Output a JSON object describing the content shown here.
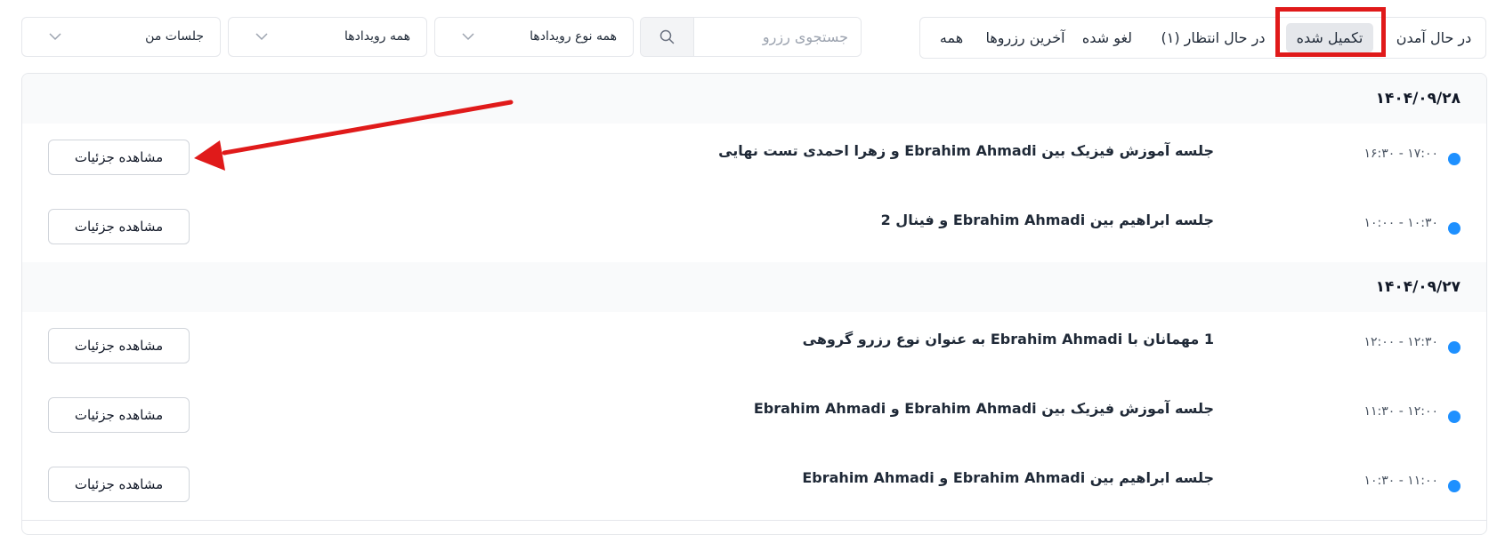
{
  "tabs": [
    {
      "label": "در حال آمدن",
      "active": false
    },
    {
      "label": "تکمیل شده",
      "active": true
    },
    {
      "label": "در حال انتظار (۱)",
      "active": false
    },
    {
      "label": "لغو شده",
      "active": false
    },
    {
      "label": "آخرین رزروها",
      "active": false
    },
    {
      "label": "همه",
      "active": false
    }
  ],
  "search": {
    "placeholder": "جستجوی رزرو"
  },
  "filters": {
    "event_type": "همه نوع رویدادها",
    "events": "همه رویدادها",
    "sessions": "جلسات من"
  },
  "details_label": "مشاهده جزئیات",
  "groups": [
    {
      "date": "۱۴۰۴/۰۹/۲۸",
      "events": [
        {
          "time": "۱۶:۳۰ - ۱۷:۰۰",
          "title": "جلسه آموزش فیزیک بین Ebrahim Ahmadi و زهرا احمدی تست نهایی"
        },
        {
          "time": "۱۰:۰۰ - ۱۰:۳۰",
          "title": "جلسه ابراهیم بین Ebrahim Ahmadi و فینال 2"
        }
      ]
    },
    {
      "date": "۱۴۰۴/۰۹/۲۷",
      "events": [
        {
          "time": "۱۲:۰۰ - ۱۲:۳۰",
          "title": "1 مهمانان با Ebrahim Ahmadi به عنوان نوع رزرو گروهی"
        },
        {
          "time": "۱۱:۳۰ - ۱۲:۰۰",
          "title": "جلسه آموزش فیزیک بین Ebrahim Ahmadi و Ebrahim Ahmadi"
        },
        {
          "time": "۱۰:۳۰ - ۱۱:۰۰",
          "title": "جلسه ابراهیم بین Ebrahim Ahmadi و Ebrahim Ahmadi"
        }
      ]
    }
  ],
  "colors": {
    "dot": "#1e90ff",
    "annotation": "#e01a1a"
  }
}
